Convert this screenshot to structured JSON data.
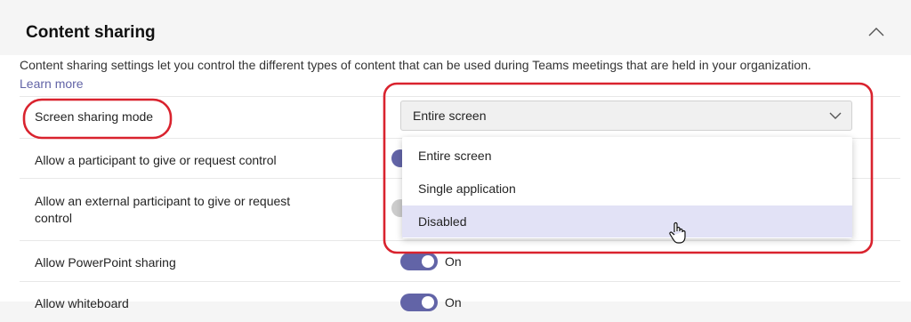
{
  "section": {
    "title": "Content sharing",
    "description": "Content sharing settings let you control the different types of content that can be used during Teams meetings that are held in your organization.",
    "learn_more": "Learn more"
  },
  "settings": [
    {
      "label": "Screen sharing mode",
      "value": "Entire screen"
    },
    {
      "label": "Allow a participant to give or request control"
    },
    {
      "label_line1": "Allow an external participant to give or request",
      "label_line2": "control"
    },
    {
      "label": "Allow PowerPoint sharing",
      "toggle": "On"
    },
    {
      "label": "Allow whiteboard",
      "toggle": "On"
    }
  ],
  "dropdown_menu": {
    "options": [
      "Entire screen",
      "Single application",
      "Disabled"
    ],
    "hovered": "Disabled"
  },
  "colors": {
    "accent": "#6264a7",
    "annotation": "#d9232e",
    "hover": "#e2e2f6"
  },
  "icons": {
    "collapse": "chevron-up-icon",
    "dropdown": "chevron-down-icon",
    "cursor": "hand-pointer-icon"
  }
}
